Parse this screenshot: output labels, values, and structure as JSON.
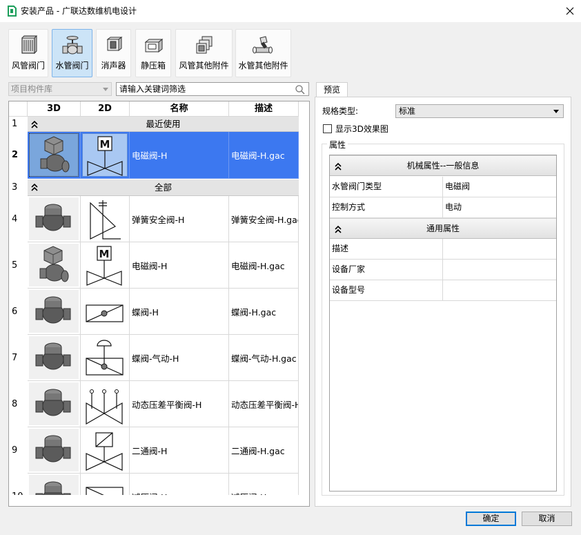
{
  "window": {
    "title": "安装产品 - 广联达数维机电设计"
  },
  "categories": [
    {
      "label": "风管阀门",
      "icon": "duct-valve-icon"
    },
    {
      "label": "水管阀门",
      "icon": "water-valve-icon"
    },
    {
      "label": "消声器",
      "icon": "silencer-icon"
    },
    {
      "label": "静压箱",
      "icon": "plenum-box-icon"
    },
    {
      "label": "风管其他附件",
      "icon": "duct-fitting-icon"
    },
    {
      "label": "水管其他附件",
      "icon": "pipe-fitting-icon"
    }
  ],
  "filter": {
    "library": "项目构件库",
    "search_placeholder": "请输入关键词筛选"
  },
  "grid": {
    "columns": [
      "3D",
      "2D",
      "名称",
      "描述"
    ],
    "group_recent": {
      "row": "1",
      "label": "最近使用"
    },
    "group_all": {
      "row": "3",
      "label": "全部"
    },
    "rows": [
      {
        "num": "2",
        "name": "电磁阀-H",
        "desc": "电磁阀-H.gac",
        "symbol": "solenoid",
        "selected": true
      },
      {
        "num": "4",
        "name": "弹簧安全阀-H",
        "desc": "弹簧安全阀-H.gac",
        "symbol": "safety"
      },
      {
        "num": "5",
        "name": "电磁阀-H",
        "desc": "电磁阀-H.gac",
        "symbol": "solenoid"
      },
      {
        "num": "6",
        "name": "蝶阀-H",
        "desc": "蝶阀-H.gac",
        "symbol": "butterfly"
      },
      {
        "num": "7",
        "name": "蝶阀-气动-H",
        "desc": "蝶阀-气动-H.gac",
        "symbol": "pneumatic"
      },
      {
        "num": "8",
        "name": "动态压差平衡阀-H",
        "desc": "动态压差平衡阀-H.gac",
        "symbol": "balance"
      },
      {
        "num": "9",
        "name": "二通阀-H",
        "desc": "二通阀-H.gac",
        "symbol": "twoway"
      },
      {
        "num": "10",
        "name": "减压阀-H",
        "desc": "减压阀-H.gac",
        "symbol": "reducing"
      }
    ]
  },
  "preview": {
    "tab_label": "预览",
    "spec_label": "规格类型:",
    "spec_value": "标准",
    "show3d_label": "显示3D效果图",
    "properties_label": "属性",
    "groups": [
      {
        "label": "机械属性--一般信息",
        "rows": [
          {
            "key": "水管阀门类型",
            "value": "电磁阀"
          },
          {
            "key": "控制方式",
            "value": "电动"
          }
        ]
      },
      {
        "label": "通用属性",
        "rows": [
          {
            "key": "描述",
            "value": ""
          },
          {
            "key": "设备厂家",
            "value": ""
          },
          {
            "key": "设备型号",
            "value": ""
          }
        ]
      }
    ]
  },
  "buttons": {
    "ok": "确定",
    "cancel": "取消"
  },
  "colors": {
    "selection": "#3c78f0",
    "accent": "#0078d7",
    "active_tool": "#cce4f7"
  }
}
